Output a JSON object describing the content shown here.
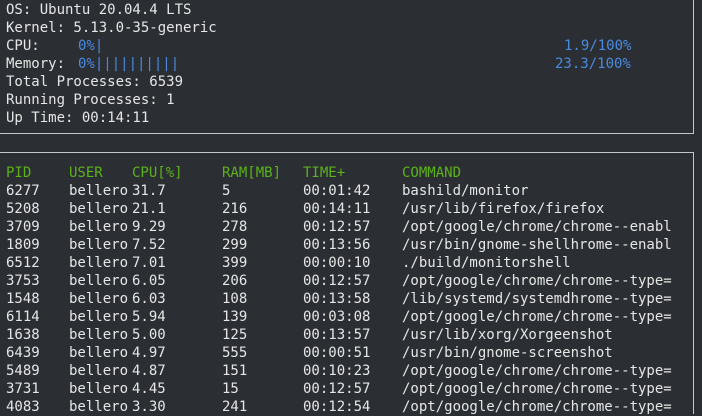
{
  "system": {
    "os": "OS: Ubuntu 20.04.4 LTS",
    "kernel": "Kernel: 5.13.0-35-generic",
    "cpu_label": "CPU:",
    "cpu_bar": "0%|",
    "cpu_value": "1.9/100%",
    "memory_label": "Memory:",
    "memory_bar": "0%||||||||||",
    "memory_value": "23.3/100%",
    "total_processes": "Total Processes: 6539",
    "running_processes": "Running Processes: 1",
    "up_time": "Up Time: 00:14:11"
  },
  "colors": {
    "accent_blue": "#4a8be0",
    "header_green": "#5bb318",
    "text": "#e6e6e6",
    "background": "#2b2e33"
  },
  "processes": {
    "headers": {
      "pid": "PID",
      "user": "USER",
      "cpu": "CPU[%]",
      "ram": "RAM[MB]",
      "time": "TIME+",
      "command": "COMMAND"
    },
    "rows": [
      {
        "pid": "6277",
        "user": "bellero",
        "cpu": "31.7",
        "ram": "5",
        "time": "00:01:42",
        "command": "bashild/monitor"
      },
      {
        "pid": "5208",
        "user": "bellero",
        "cpu": "21.1",
        "ram": "216",
        "time": "00:14:11",
        "command": "/usr/lib/firefox/firefox"
      },
      {
        "pid": "3709",
        "user": "bellero",
        "cpu": "9.29",
        "ram": "278",
        "time": "00:12:57",
        "command": "/opt/google/chrome/chrome--enabl"
      },
      {
        "pid": "1809",
        "user": "bellero",
        "cpu": "7.52",
        "ram": "299",
        "time": "00:13:56",
        "command": "/usr/bin/gnome-shellhrome--enabl"
      },
      {
        "pid": "6512",
        "user": "bellero",
        "cpu": "7.01",
        "ram": "399",
        "time": "00:00:10",
        "command": "./build/monitorshell"
      },
      {
        "pid": "3753",
        "user": "bellero",
        "cpu": "6.05",
        "ram": "206",
        "time": "00:12:57",
        "command": "/opt/google/chrome/chrome--type="
      },
      {
        "pid": "1548",
        "user": "bellero",
        "cpu": "6.03",
        "ram": "108",
        "time": "00:13:58",
        "command": "/lib/systemd/systemdhrome--type="
      },
      {
        "pid": "6114",
        "user": "bellero",
        "cpu": "5.94",
        "ram": "139",
        "time": "00:03:08",
        "command": "/opt/google/chrome/chrome--type="
      },
      {
        "pid": "1638",
        "user": "bellero",
        "cpu": "5.00",
        "ram": "125",
        "time": "00:13:57",
        "command": "/usr/lib/xorg/Xorgeenshot"
      },
      {
        "pid": "6439",
        "user": "bellero",
        "cpu": "4.97",
        "ram": "555",
        "time": "00:00:51",
        "command": "/usr/bin/gnome-screenshot"
      },
      {
        "pid": "5489",
        "user": "bellero",
        "cpu": "4.87",
        "ram": "151",
        "time": "00:10:23",
        "command": "/opt/google/chrome/chrome--type="
      },
      {
        "pid": "3731",
        "user": "bellero",
        "cpu": "4.45",
        "ram": "15",
        "time": "00:12:57",
        "command": "/opt/google/chrome/chrome--type="
      },
      {
        "pid": "4083",
        "user": "bellero",
        "cpu": "3.30",
        "ram": "241",
        "time": "00:12:54",
        "command": "/opt/google/chrome/chrome--type="
      }
    ]
  }
}
